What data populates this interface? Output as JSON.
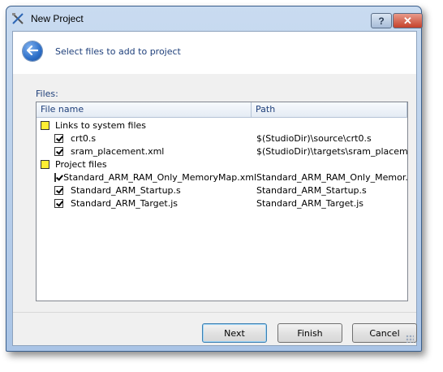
{
  "window": {
    "title": "New Project",
    "help_glyph": "?",
    "close_glyph": "✕"
  },
  "header": {
    "instruction": "Select files to add to project"
  },
  "files": {
    "label": "Files:",
    "columns": {
      "file_name": "File name",
      "path": "Path"
    },
    "groups": [
      {
        "name": "Links to system files",
        "items": [
          {
            "name": "crt0.s",
            "path": "$(StudioDir)\\source\\crt0.s",
            "checked": true
          },
          {
            "name": "sram_placement.xml",
            "path": "$(StudioDir)\\targets\\sram_placeme...",
            "checked": true
          }
        ]
      },
      {
        "name": "Project files",
        "items": [
          {
            "name": "Standard_ARM_RAM_Only_MemoryMap.xml",
            "path": "Standard_ARM_RAM_Only_Memor...",
            "checked": true
          },
          {
            "name": "Standard_ARM_Startup.s",
            "path": "Standard_ARM_Startup.s",
            "checked": true
          },
          {
            "name": "Standard_ARM_Target.js",
            "path": "Standard_ARM_Target.js",
            "checked": true
          }
        ]
      }
    ]
  },
  "buttons": {
    "next": "Next",
    "finish": "Finish",
    "cancel": "Cancel"
  },
  "icons": {
    "app": "crossed-tools-icon",
    "back": "back-arrow-icon",
    "folder": "yellow-folder-icon",
    "checkbox": "checkbox-checked-icon",
    "grip": "resize-grip-icon"
  },
  "colors": {
    "accent_text": "#1e3f7a",
    "folder_fill": "#ffee33",
    "default_button_border": "#3c7fb1"
  }
}
